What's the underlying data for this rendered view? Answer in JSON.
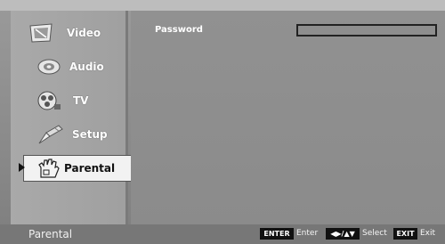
{
  "menu": {
    "items": [
      {
        "label": "Video",
        "icon": "video-icon"
      },
      {
        "label": "Audio",
        "icon": "audio-icon"
      },
      {
        "label": "TV",
        "icon": "tv-icon"
      },
      {
        "label": "Setup",
        "icon": "setup-icon"
      },
      {
        "label": "Parental",
        "icon": "parental-icon",
        "selected": true
      }
    ]
  },
  "content": {
    "password_label": "Password",
    "password_value": ""
  },
  "footer": {
    "title": "Parental",
    "hints": [
      {
        "key": "ENTER",
        "action": "Enter"
      },
      {
        "key": "◀▶/▲▼",
        "action": "Select"
      },
      {
        "key": "EXIT",
        "action": "Exit"
      }
    ]
  }
}
